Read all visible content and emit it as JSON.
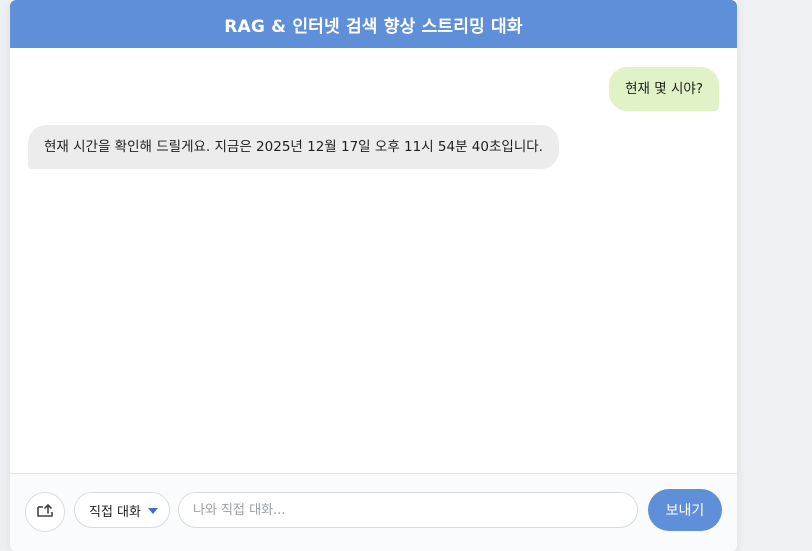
{
  "header": {
    "title": "RAG & 인터넷 검색 향상 스트리밍 대화"
  },
  "messages": [
    {
      "role": "user",
      "text": "현재 몇 시야?"
    },
    {
      "role": "assistant",
      "text": "현재 시간을 확인해 드릴게요. 지금은 2025년 12월 17일 오후 11시 54분 40초입니다."
    }
  ],
  "input_bar": {
    "upload_icon": "upload-icon",
    "mode_select": {
      "selected": "직접 대화"
    },
    "input": {
      "placeholder": "나와 직접 대화...",
      "value": ""
    },
    "send_label": "보내기"
  },
  "colors": {
    "accent": "#5f8fd8",
    "user_bubble": "#dff3c6",
    "bot_bubble": "#ececec"
  }
}
